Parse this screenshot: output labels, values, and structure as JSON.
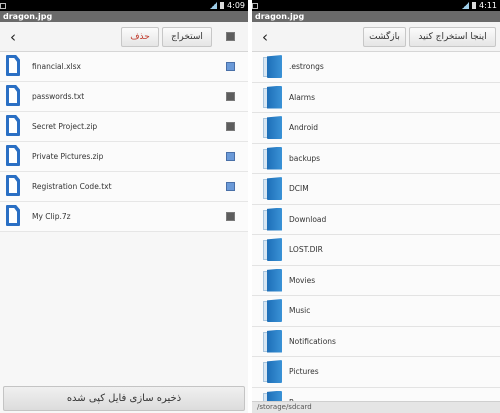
{
  "left": {
    "status_time": "4:09",
    "title": "dragon.jpg",
    "toolbar": {
      "extract_label": "استخراج",
      "delete_label": "حذف"
    },
    "files": [
      {
        "name": "financial.xlsx",
        "checked": true
      },
      {
        "name": "passwords.txt",
        "checked": false
      },
      {
        "name": "Secret Project.zip",
        "checked": false
      },
      {
        "name": "Private Pictures.zip",
        "checked": true
      },
      {
        "name": "Registration Code.txt",
        "checked": true
      },
      {
        "name": "My Clip.7z",
        "checked": false
      }
    ],
    "save_label": "ذخیره سازی فایل کپی شده"
  },
  "right": {
    "status_time": "4:11",
    "title": "dragon.jpg",
    "toolbar": {
      "back_label": "بازگشت",
      "extract_here_label": "اینجا استخراج کنید"
    },
    "folders": [
      ".estrongs",
      "Alarms",
      "Android",
      "backups",
      "DCIM",
      "Download",
      "LOST.DIR",
      "Movies",
      "Music",
      "Notifications",
      "Pictures",
      "P..."
    ],
    "path": "/storage/sdcard"
  },
  "colors": {
    "accent": "#2a6fc4",
    "checked": "#6b9ad8",
    "unchecked": "#5d5d5d",
    "delete_text": "#c0392b"
  }
}
